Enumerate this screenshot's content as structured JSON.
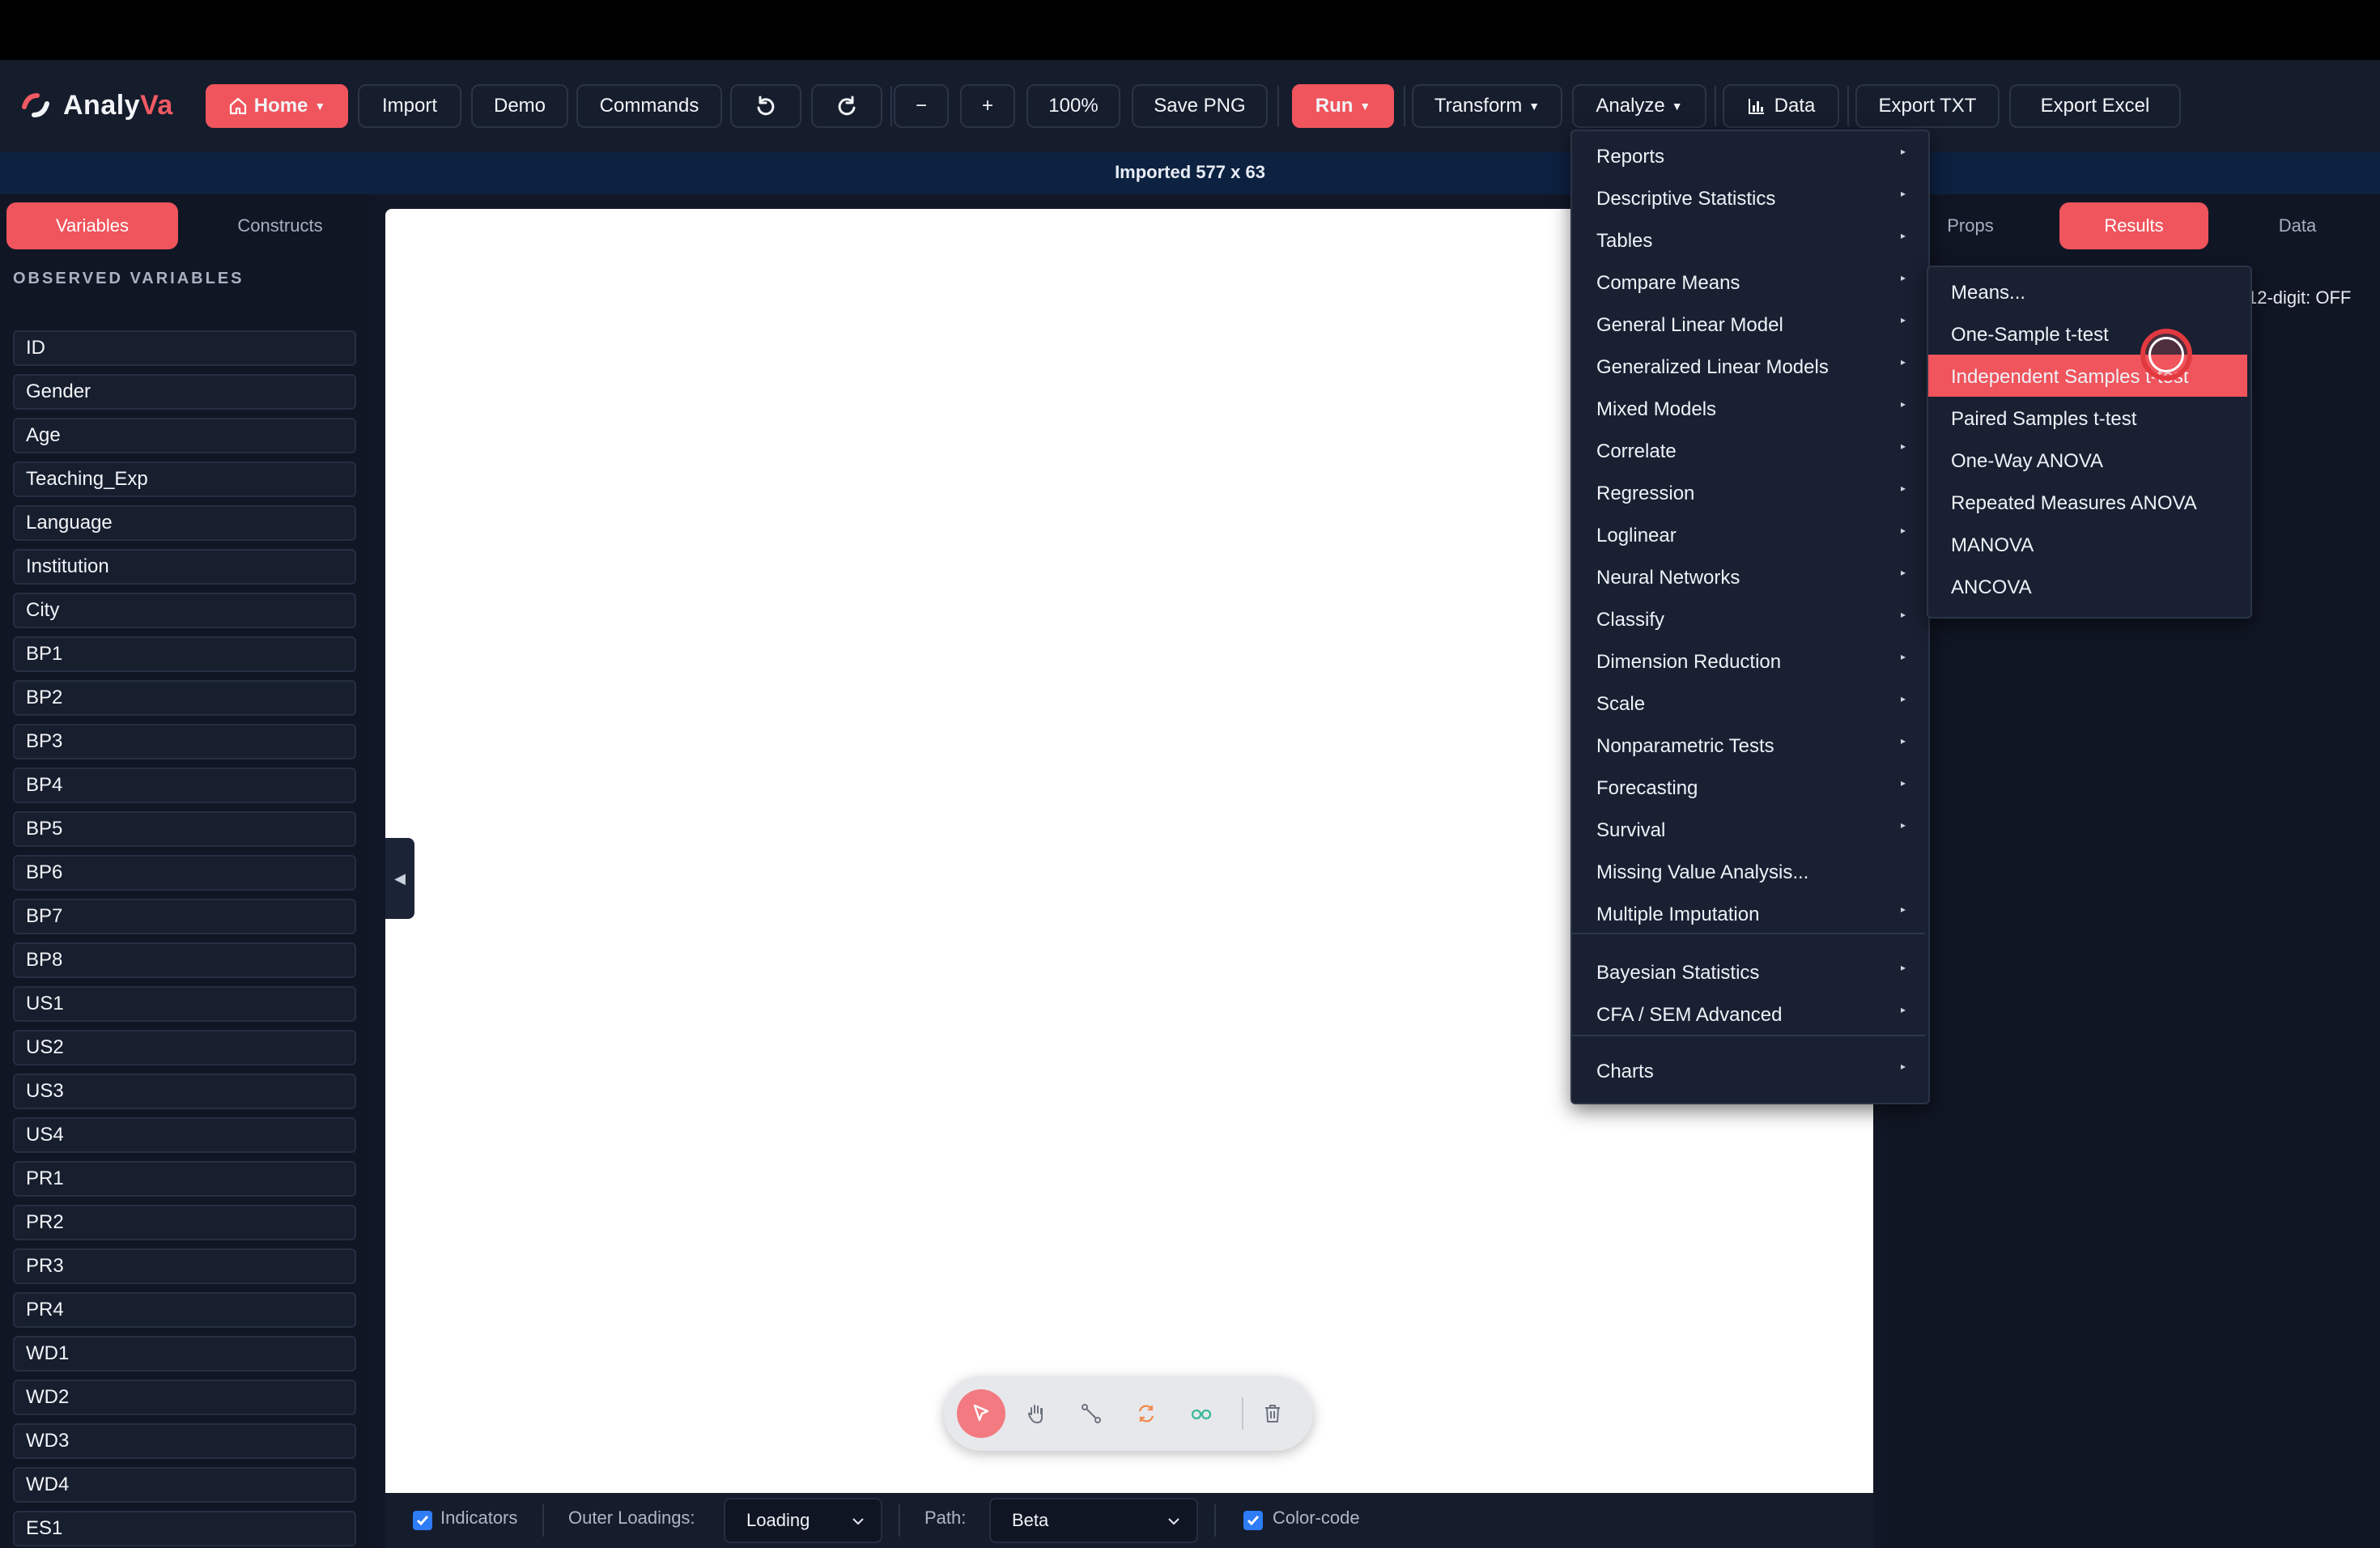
{
  "app": {
    "name_part1": "Analy",
    "name_part2": "Va"
  },
  "toolbar": {
    "home": "Home",
    "import": "Import",
    "demo": "Demo",
    "commands": "Commands",
    "zoom_out": "−",
    "zoom_in": "+",
    "zoom_level": "100%",
    "save_png": "Save PNG",
    "run": "Run",
    "transform": "Transform",
    "analyze": "Analyze",
    "data": "Data",
    "export_txt": "Export TXT",
    "export_excel": "Export Excel"
  },
  "status": {
    "message": "Imported 577 x 63"
  },
  "left_panel": {
    "tabs": [
      "Variables",
      "Constructs"
    ],
    "section_title": "OBSERVED VARIABLES",
    "variables": [
      "ID",
      "Gender",
      "Age",
      "Teaching_Exp",
      "Language",
      "Institution",
      "City",
      "BP1",
      "BP2",
      "BP3",
      "BP4",
      "BP5",
      "BP6",
      "BP7",
      "BP8",
      "US1",
      "US2",
      "US3",
      "US4",
      "PR1",
      "PR2",
      "PR3",
      "PR4",
      "WD1",
      "WD2",
      "WD3",
      "WD4",
      "ES1"
    ]
  },
  "right_panel": {
    "tabs": [
      "Props",
      "Results",
      "Data"
    ],
    "active_tab": "Results",
    "digit_toggle": "12-digit: OFF"
  },
  "analyze_menu": {
    "group1": [
      "Reports",
      "Descriptive Statistics",
      "Tables",
      "Compare Means",
      "General Linear Model",
      "Generalized Linear Models",
      "Mixed Models",
      "Correlate",
      "Regression",
      "Loglinear",
      "Neural Networks",
      "Classify",
      "Dimension Reduction",
      "Scale",
      "Nonparametric Tests",
      "Forecasting",
      "Survival",
      "Missing Value Analysis...",
      "Multiple Imputation"
    ],
    "group2": [
      "Bayesian Statistics",
      "CFA / SEM Advanced"
    ],
    "group3": [
      "Charts"
    ]
  },
  "compare_means_submenu": {
    "items": [
      "Means...",
      "One-Sample t-test",
      "Independent Samples t-test",
      "Paired Samples t-test",
      "One-Way ANOVA",
      "Repeated Measures ANOVA",
      "MANOVA",
      "ANCOVA"
    ],
    "highlighted": "Independent Samples t-test"
  },
  "canvas_tools": [
    "select-tool",
    "pan-tool",
    "connect-tool",
    "rotate-tool",
    "link-tool",
    "delete-tool"
  ],
  "bottom_bar": {
    "indicators_label": "Indicators",
    "indicators_checked": true,
    "outer_loadings_label": "Outer Loadings:",
    "outer_loadings_value": "Loading",
    "path_label": "Path:",
    "path_value": "Beta",
    "color_code_label": "Color-code",
    "color_code_checked": true
  },
  "colors": {
    "accent": "#f0545c",
    "background": "#0f1524",
    "checkbox": "#2e7cf6"
  }
}
